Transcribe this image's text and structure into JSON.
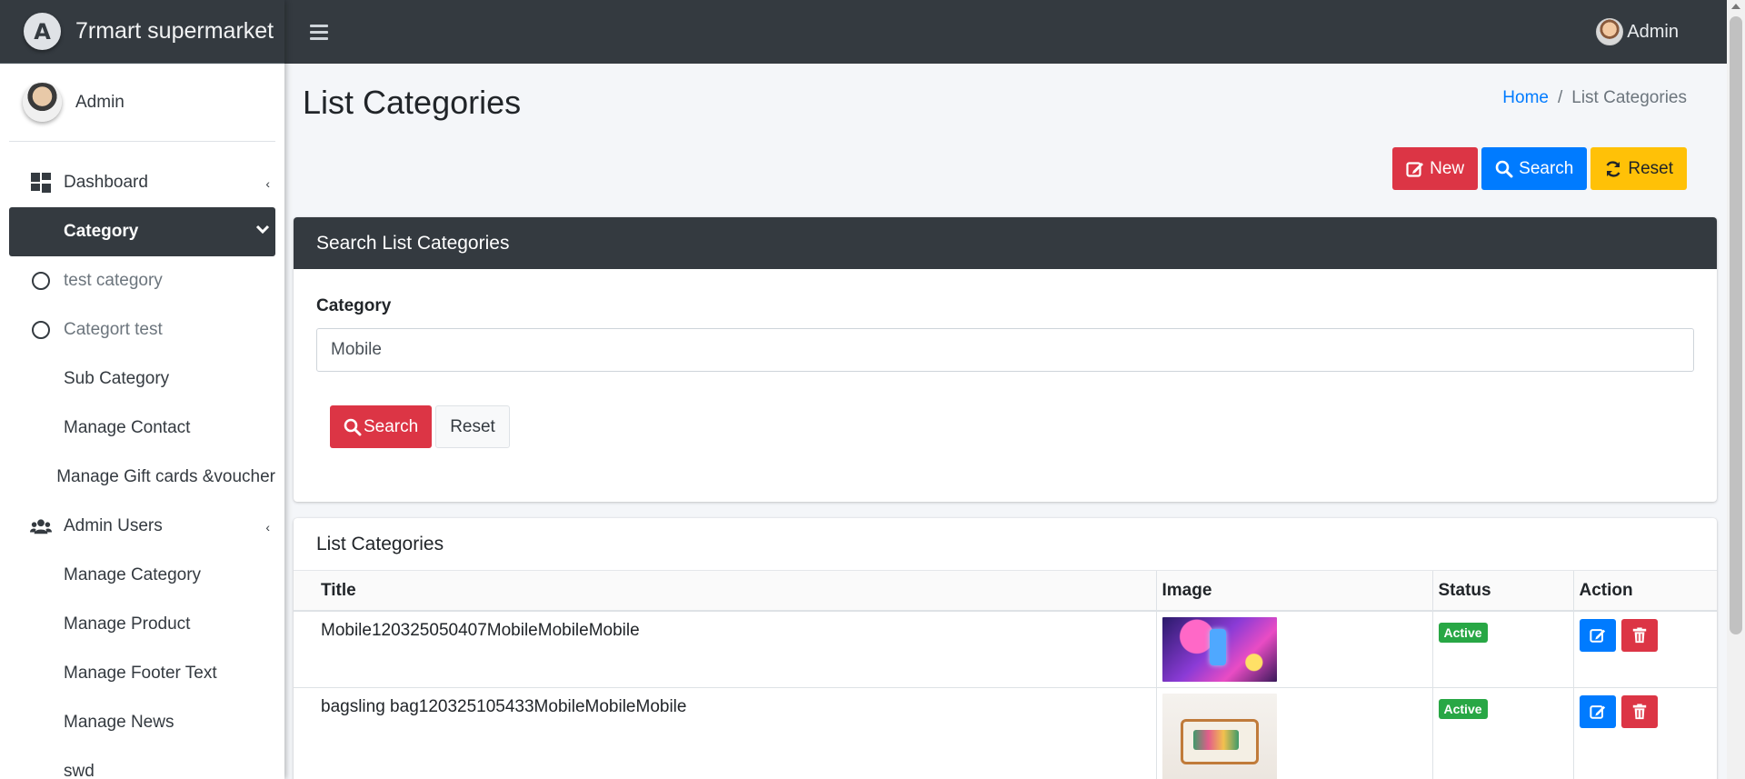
{
  "brand": {
    "logo_letter": "A",
    "name": "7rmart supermarket"
  },
  "sidebar": {
    "user_name": "Admin",
    "items": [
      {
        "label": "Dashboard",
        "icon": "dashboard-icon"
      },
      {
        "label": "Category",
        "icon": "none",
        "active": true
      },
      {
        "label": "test category",
        "icon": "circle-icon"
      },
      {
        "label": "Categort test",
        "icon": "circle-icon"
      },
      {
        "label": "Sub Category"
      },
      {
        "label": "Manage Contact"
      },
      {
        "label": "Manage Gift cards &voucher"
      },
      {
        "label": "Admin Users",
        "icon": "users-icon"
      },
      {
        "label": "Manage Category"
      },
      {
        "label": "Manage Product"
      },
      {
        "label": "Manage Footer Text"
      },
      {
        "label": "Manage News"
      },
      {
        "label": "swd"
      }
    ]
  },
  "topbar": {
    "user_name": "Admin"
  },
  "page": {
    "title": "List Categories",
    "breadcrumb": {
      "home": "Home",
      "separator": "/",
      "current": "List Categories"
    },
    "buttons": {
      "new": "New",
      "search": "Search",
      "reset": "Reset"
    }
  },
  "search_card": {
    "title": "Search List Categories",
    "field_label": "Category",
    "field_value": "Mobile",
    "search_button": "Search",
    "reset_button": "Reset"
  },
  "list_card": {
    "title": "List Categories",
    "columns": [
      "Title",
      "Image",
      "Status",
      "Action"
    ],
    "rows": [
      {
        "title": "Mobile120325050407MobileMobileMobile",
        "image": "phone-thumbnail",
        "status": "Active"
      },
      {
        "title": "bagsling bag120325105433MobileMobileMobile",
        "image": "bag-thumbnail",
        "status": "Active"
      }
    ]
  },
  "colors": {
    "dark": "#343a40",
    "primary": "#007bff",
    "danger": "#dc3545",
    "warning": "#ffc107",
    "success": "#28a745"
  }
}
